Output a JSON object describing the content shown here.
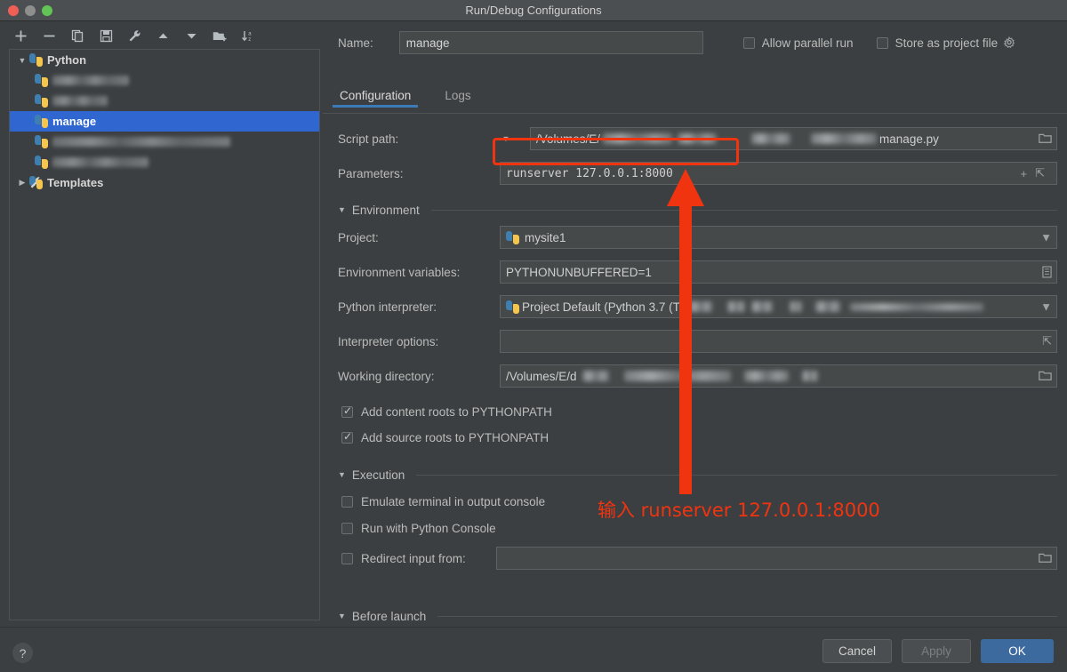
{
  "window": {
    "title": "Run/Debug Configurations",
    "traffic_lights": [
      "close-red",
      "minimize-gray",
      "zoom-green"
    ]
  },
  "sidebar": {
    "toolbar": [
      {
        "name": "add-configuration",
        "glyph": "+"
      },
      {
        "name": "remove-configuration",
        "glyph": "−"
      },
      {
        "name": "copy-configuration",
        "glyph": "❐"
      },
      {
        "name": "save-configuration",
        "glyph": "ὋE"
      },
      {
        "name": "edit-templates",
        "glyph": "ὒ7"
      },
      {
        "name": "move-up",
        "glyph": "▲"
      },
      {
        "name": "move-down",
        "glyph": "▼"
      },
      {
        "name": "new-folder",
        "glyph": "Ὄ1"
      },
      {
        "name": "sort-alphabetically",
        "glyph": "↓"
      }
    ],
    "tree": [
      {
        "label": "Python",
        "type": "group",
        "expanded": true,
        "depth": 0,
        "selected": false,
        "redacted": false
      },
      {
        "label": "",
        "type": "config",
        "depth": 1,
        "selected": false,
        "redacted": true,
        "redact_style": "s1"
      },
      {
        "label": "",
        "type": "config",
        "depth": 1,
        "selected": false,
        "redacted": true,
        "redact_style": "s2"
      },
      {
        "label": "manage",
        "type": "config",
        "depth": 1,
        "selected": true,
        "redacted": false
      },
      {
        "label": "",
        "type": "config",
        "depth": 1,
        "selected": false,
        "redacted": true,
        "redact_style": "s3"
      },
      {
        "label": "",
        "type": "config",
        "depth": 1,
        "selected": false,
        "redacted": true,
        "redact_style": "s4"
      },
      {
        "label": "Templates",
        "type": "group",
        "expanded": false,
        "depth": 0,
        "selected": false,
        "redacted": false
      }
    ]
  },
  "header": {
    "name_label": "Name:",
    "name_value": "manage",
    "allow_parallel_run": {
      "label": "Allow parallel run",
      "checked": false
    },
    "store_as_project_file": {
      "label": "Store as project file",
      "checked": false
    }
  },
  "tabs": [
    {
      "label": "Configuration",
      "active": true
    },
    {
      "label": "Logs",
      "active": false
    }
  ],
  "form": {
    "script_path": {
      "label": "Script path:",
      "value_prefix": "/Volumes/E/",
      "value_suffix": "manage.py",
      "redacted": true
    },
    "parameters": {
      "label": "Parameters:",
      "value": "runserver 127.0.0.1:8000",
      "highlighted": true
    },
    "environment_section": "Environment",
    "project": {
      "label": "Project:",
      "value": "mysite1"
    },
    "environment_variables": {
      "label": "Environment variables:",
      "value": "PYTHONUNBUFFERED=1"
    },
    "python_interpreter": {
      "label": "Python interpreter:",
      "value": "Project Default (Python 3.7 (T",
      "redacted": true
    },
    "interpreter_options": {
      "label": "Interpreter options:",
      "value": ""
    },
    "working_directory": {
      "label": "Working directory:",
      "value_prefix": "/Volumes/E/d",
      "redacted": true
    },
    "add_content_roots": {
      "label": "Add content roots to PYTHONPATH",
      "checked": true
    },
    "add_source_roots": {
      "label": "Add source roots to PYTHONPATH",
      "checked": true
    },
    "execution_section": "Execution",
    "emulate_terminal": {
      "label": "Emulate terminal in output console",
      "checked": false
    },
    "run_with_python_console": {
      "label": "Run with Python Console",
      "checked": false
    },
    "redirect_input_from": {
      "label": "Redirect input from:",
      "checked": false,
      "value": ""
    },
    "before_launch_section": "Before launch"
  },
  "footer": {
    "help_label": "?",
    "cancel_label": "Cancel",
    "apply_label": "Apply",
    "ok_label": "OK"
  },
  "annotations": {
    "callout_text": "输入 runserver 127.0.0.1:8000",
    "color": "#f0340f"
  }
}
